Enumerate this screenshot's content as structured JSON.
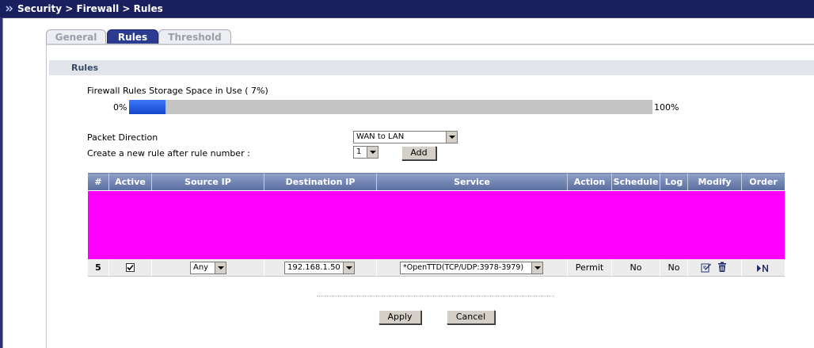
{
  "breadcrumb": "Security > Firewall > Rules",
  "tabs": [
    {
      "label": "General"
    },
    {
      "label": "Rules"
    },
    {
      "label": "Threshold"
    }
  ],
  "section_title": "Rules",
  "storage": {
    "label": "Firewall Rules Storage Space in Use  ( 7%)",
    "min_label": "0%",
    "max_label": "100%",
    "percent": 7
  },
  "packet_direction": {
    "label": "Packet Direction",
    "value": "WAN to LAN"
  },
  "new_rule": {
    "label": "Create a new rule after rule number :",
    "value": "1",
    "add_label": "Add"
  },
  "table": {
    "headers": [
      "#",
      "Active",
      "Source IP",
      "Destination IP",
      "Service",
      "Action",
      "Schedule",
      "Log",
      "Modify",
      "Order"
    ],
    "row": {
      "number": "5",
      "active": true,
      "source_ip": "Any",
      "destination_ip": "192.168.1.50",
      "service": "*OpenTTD(TCP/UDP:3978-3979)",
      "action": "Permit",
      "schedule": "No",
      "log": "No"
    }
  },
  "buttons": {
    "apply": "Apply",
    "cancel": "Cancel"
  },
  "colors": {
    "title_bar": "#1a1f5e",
    "active_tab": "#2b3b8f",
    "progress_fill": "#1447c8",
    "table_header": "#6a7eb0",
    "highlight": "#ff00ff"
  }
}
